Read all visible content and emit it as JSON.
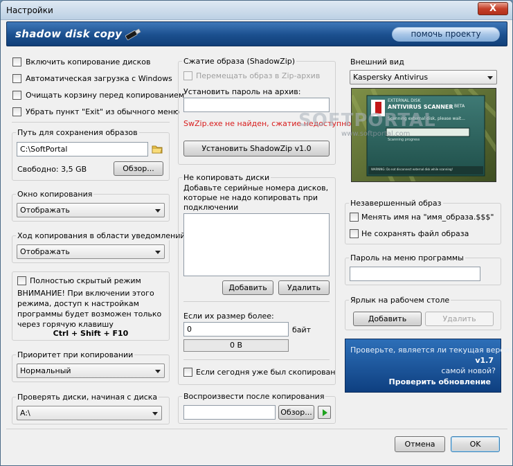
{
  "window": {
    "title": "Настройки",
    "close_glyph": "X"
  },
  "banner": {
    "logo": "shadow disk copy",
    "help_button": "помочь проекту"
  },
  "options": {
    "enable_copy": "Включить копирование дисков",
    "autoload": "Автоматическая загрузка с Windows",
    "clear_recycle": "Очищать корзину перед копированием",
    "remove_exit": "Убрать пункт \"Exit\" из обычного меню"
  },
  "save_path": {
    "title": "Путь для сохранения образов",
    "value": "C:\\SoftPortal",
    "free_label": "Свободно: 3,5 GB",
    "browse": "Обзор..."
  },
  "copy_window": {
    "title": "Окно копирования",
    "selected": "Отображать"
  },
  "tray_progress": {
    "title": "Ход копирования в области уведомлений",
    "selected": "Отображать"
  },
  "hidden_mode": {
    "label": "Полностью скрытый режим",
    "warning": "ВНИМАНИЕ! При включении этого режима, доступ к настройкам программы будет возможен только через горячую клавишу",
    "hotkey": "Ctrl + Shift + F10"
  },
  "priority": {
    "title": "Приоритет при копировании",
    "selected": "Нормальный"
  },
  "check_from": {
    "title": "Проверять диски, начиная с диска",
    "selected": "A:\\"
  },
  "shadowzip": {
    "title": "Сжатие образа (ShadowZip)",
    "move_to_zip": "Перемещать образ в Zip-архив",
    "password_label": "Установить пароль на архив:",
    "password_value": "",
    "error": "SwZip.exe не найден, сжатие недоступно!",
    "install_button": "Установить ShadowZip v1.0"
  },
  "no_copy": {
    "title": "Не копировать диски",
    "description": "Добавьте серийные номера дисков, которые не надо копировать при подключении",
    "add": "Добавить",
    "remove": "Удалить",
    "size_label": "Если их размер более:",
    "size_value": "0",
    "size_unit": "байт",
    "size_display": "0 B",
    "already_copied": "Если сегодня уже был скопирован"
  },
  "play_after": {
    "title": "Воспроизвести после копирования",
    "value": "",
    "browse": "Обзор..."
  },
  "appearance": {
    "title": "Внешний вид",
    "selected": "Kaspersky Antivirus",
    "preview_title": "ANTIVIRUS SCANNER",
    "preview_small": "EXTERNAL DISK",
    "preview_beta": "BETA",
    "preview_status": "Scanning external disk, please wait...",
    "preview_progress": "Scanning progress",
    "preview_warning": "WARNING: Do not disconnect external disk while scanning!",
    "watermark": "SOFTPORTAL",
    "watermark_url": "www.softportal.com"
  },
  "incomplete": {
    "title": "Незавершенный образ",
    "rename": "Менять имя на \"имя_образа.$$$\"",
    "dont_save": "Не сохранять файл образа"
  },
  "menu_password": {
    "title": "Пароль на меню программы",
    "value": ""
  },
  "desktop_shortcut": {
    "title": "Ярлык на рабочем столе",
    "add": "Добавить",
    "remove": "Удалить"
  },
  "update": {
    "question": "Проверьте, является ли текущая версия",
    "version": "v1.7",
    "latest": "самой новой?",
    "button": "Проверить обновление"
  },
  "footer": {
    "cancel": "Отмена",
    "ok": "OK"
  }
}
